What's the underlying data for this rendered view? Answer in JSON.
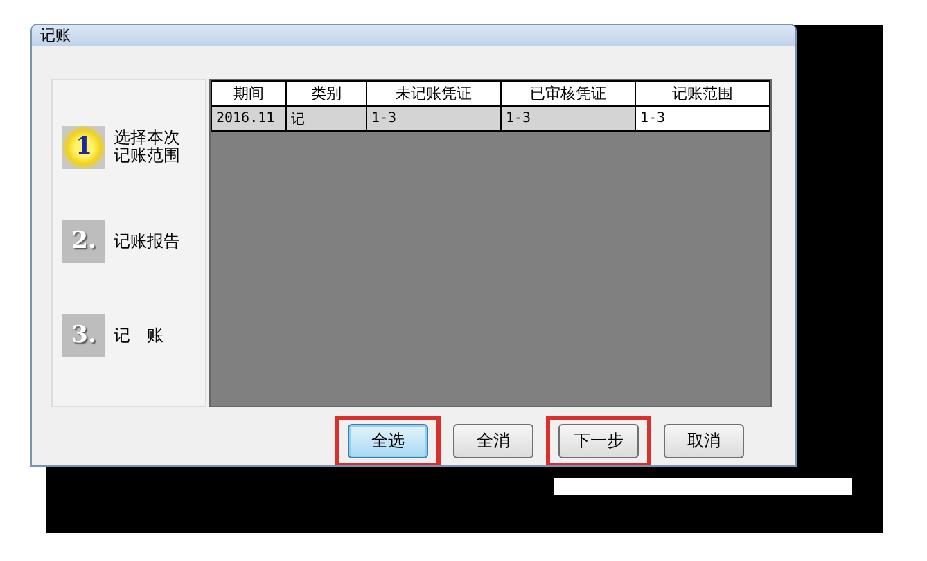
{
  "window": {
    "title": "记账"
  },
  "steps": [
    {
      "number": "1",
      "label": "选择本次记账范围",
      "selected": true
    },
    {
      "number": "2.",
      "label": "记账报告",
      "selected": false
    },
    {
      "number": "3.",
      "label": "记　账",
      "selected": false
    }
  ],
  "table": {
    "columns": [
      "期间",
      "类别",
      "未记账凭证",
      "已审核凭证",
      "记账范围"
    ],
    "rows": [
      {
        "cells": [
          {
            "text": "2016.11",
            "focused": false
          },
          {
            "text": "记",
            "focused": false
          },
          {
            "text": "1-3",
            "focused": false
          },
          {
            "text": "1-3",
            "focused": false
          },
          {
            "text": "1-3",
            "focused": true
          }
        ]
      }
    ]
  },
  "buttons": [
    {
      "label": "全选",
      "default": true,
      "highlighted": true
    },
    {
      "label": "全消",
      "default": false,
      "highlighted": false
    },
    {
      "label": "下一步",
      "default": false,
      "highlighted": true
    },
    {
      "label": "取消",
      "default": false,
      "highlighted": false
    }
  ]
}
